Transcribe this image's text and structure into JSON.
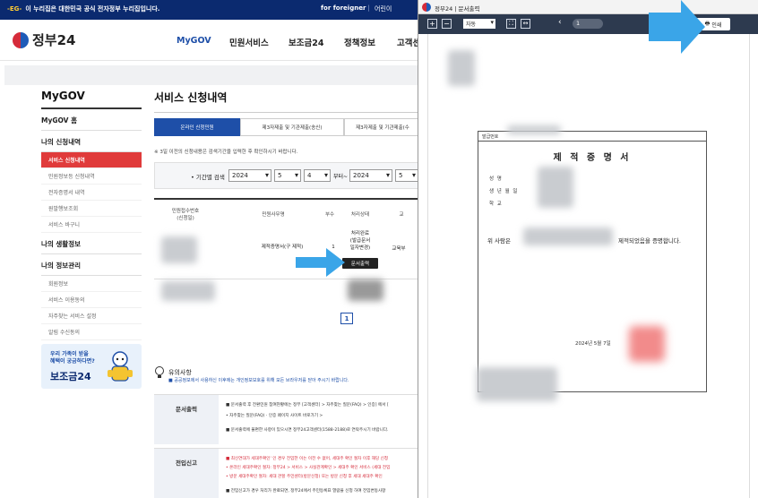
{
  "topbar": {
    "notice_prefix": "-EG-",
    "notice": "이 누리집은 대한민국 공식 전자정부 누리집입니다.",
    "foreigner": "for foreigner",
    "lang_link": "어린이"
  },
  "header": {
    "logo_text": "정부24",
    "gnb": [
      "MyGOV",
      "민원서비스",
      "보조금24",
      "정책정보",
      "고객센"
    ]
  },
  "sidebar": {
    "title": "MyGOV",
    "home": "MyGOV 홈",
    "group1": "나의 신청내역",
    "group1_items": [
      "서비스 신청내역",
      "민원정보등 신청내역",
      "전자증명서 내역",
      "원발행보조회",
      "서비스 바구니"
    ],
    "group2": "나의 생활정보",
    "group3": "나의 정보관리",
    "group3_items": [
      "회원정보",
      "서비스 이용동의",
      "자주찾는 서비스 설정",
      "알림 수신동의",
      "회원탈퇴"
    ],
    "banner_line1": "우리 가족이 받을",
    "banner_line2": "혜택이 궁금하다면?",
    "banner_brand": "보조금24"
  },
  "main": {
    "title": "서비스 신청내역",
    "tabs": [
      "온라인 신청민원",
      "제3자제출 및 기관제출(송신)",
      "제3자제출 및 기관제출(수"
    ],
    "desc": "※ 3일 이전의 신청내용은 검색기간을 입력한 후 확인하시기 바랍니다.",
    "filter_label": "• 기간별 검색",
    "from_year": "2024",
    "from_month": "5",
    "from_day": "4",
    "from_suffix": "부터~",
    "to_year": "2024",
    "to_month": "5",
    "table_headers": [
      "민원접수번호\n(신청일)",
      "민원사무명",
      "부수",
      "처리상태",
      "교"
    ],
    "row_name": "제적증명서(구 제적)",
    "row_count": "1",
    "row_status": "처리완료\n(발급문서\n일자변경)",
    "row_org": "교육부",
    "print_button": "문서출력",
    "page_current": "1",
    "notes_title": "유의사항",
    "notes_desc": "■ 공공정보에서 사용하신 이후에는 개인정보보호를 위해 모든 브라우저를 닫아 주시기 바랍니다.",
    "block1_label": "문서출력",
    "block1_lines": [
      "■ 문서출력 후 전환민원 참여현황에는 정부 [고객센터] > 자주찾는 질문(FAQ) > 인증] 에서 [",
      "• 자주찾는 질문(FAQ) · 인증 페이지   사이트 바로가기 >",
      "■ 문서출력에 불편한 사항이 있으시면 정부24고객센터(1588-2188)로 연락주시기 바랍니다."
    ],
    "block2_label": "전입신고",
    "block2_lines": [
      "■ 최신연대가 세대주확인' 인 경우 전입한 이는 이전 수 없어, 세대주 확인 절차 이후 해당 신청",
      "• 온라인 세대주확인 절차: 정부24 > 서비스 > 사실관계확인 > 세대주 확인 서비스 (세대 전입",
      "• 방문 세대주확인 절차: 세대 관할 주민센터(방문신청) 또는 방문 신청 후 세대 세대주 확인",
      "■ 전입신고가 경우 처리가 완료되면, 정부24에서 주민등록표 열람을 신청 하여 전입변동사항"
    ]
  },
  "viewer": {
    "window_title": "정부24 | 문서출력",
    "zoom": "자동",
    "page": "1",
    "print_label": "인쇄",
    "cert_no_label": "발급번호",
    "cert_title": "제 적 증 명 서",
    "field1": "성       명",
    "field2": "생 년 월 일",
    "field3": "학       교",
    "body_prefix": "위 사람은",
    "body_suffix": "제적되었음을 증명합니다.",
    "issue_date": "2024년 5월 7일"
  },
  "colors": {
    "accent": "#1e4fa8",
    "topbar": "#0b2a6f",
    "active": "#e03b3b",
    "arrow": "#3aa5e8"
  }
}
